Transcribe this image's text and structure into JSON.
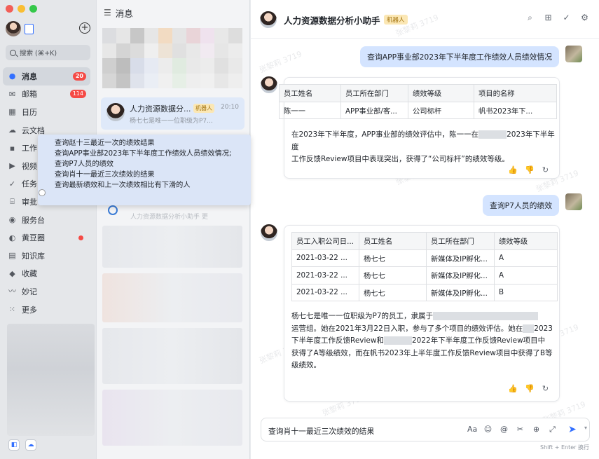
{
  "sidebar": {
    "search_placeholder": "搜索 (⌘+K)",
    "items": [
      {
        "label": "消息",
        "icon": "message-icon",
        "badge": "20",
        "active": true
      },
      {
        "label": "邮箱",
        "icon": "mail-icon",
        "badge": "114"
      },
      {
        "label": "日历",
        "icon": "calendar-icon"
      },
      {
        "label": "云文档",
        "icon": "cloud-docs-icon"
      },
      {
        "label": "工作",
        "icon": "workplace-icon"
      },
      {
        "label": "视频",
        "icon": "video-icon"
      },
      {
        "label": "任务",
        "icon": "task-icon"
      },
      {
        "label": "审批",
        "icon": "approval-icon"
      },
      {
        "label": "服务台",
        "icon": "service-desk-icon"
      },
      {
        "label": "黄豆圈",
        "icon": "moments-icon",
        "dot": true
      },
      {
        "label": "知识库",
        "icon": "wiki-icon"
      },
      {
        "label": "收藏",
        "icon": "favorites-icon"
      },
      {
        "label": "妙记",
        "icon": "minutes-icon"
      },
      {
        "label": "更多",
        "icon": "more-icon"
      }
    ]
  },
  "list": {
    "title": "消息",
    "chat": {
      "name": "人力资源数据分...",
      "tag": "机器人",
      "time": "20:10",
      "preview": "杨七七是唯一一位职级为P7..."
    },
    "second_preview": "人力资源数据分析小助手 更"
  },
  "popup": {
    "lines": [
      "查询赵十三最近一次的绩效结果",
      "查询APP事业部2023年下半年度工作绩效人员绩效情况;",
      "查询P7人员的绩效",
      "查询肖十一最近三次绩效的结果",
      "查询最新绩效和上一次绩效相比有下滑的人"
    ]
  },
  "header": {
    "title": "人力资源数据分析小助手",
    "tag": "机器人"
  },
  "watermark": "张黎莉 3719",
  "messages": {
    "q1": "查询APP事业部2023年下半年度工作绩效人员绩效情况",
    "a1": {
      "columns": [
        "员工姓名",
        "员工所在部门",
        "绩效等级",
        "项目的名称"
      ],
      "rows": [
        [
          "陈一一",
          "APP事业部/客...",
          "公司标杆",
          "帆书2023年下..."
        ]
      ],
      "text_line1_a": "在2023年下半年度，APP事业部的绩效评估中，陈一一在",
      "text_line1_b": "2023年下半年度",
      "text_line2": "工作反馈Review项目中表现突出，获得了“公司标杆”的绩效等级。"
    },
    "q2": "查询P7人员的绩效",
    "a2": {
      "columns": [
        "员工入职公司日...",
        "员工姓名",
        "员工所在部门",
        "绩效等级"
      ],
      "rows": [
        [
          "2021-03-22 ...",
          "杨七七",
          "新媒体及IP孵化...",
          "A"
        ],
        [
          "2021-03-22 ...",
          "杨七七",
          "新媒体及IP孵化...",
          "A"
        ],
        [
          "2021-03-22 ...",
          "杨七七",
          "新媒体及IP孵化...",
          "B"
        ]
      ],
      "line1": "杨七七是唯一一位职级为P7的员工，隶属于",
      "line2_a": "运营组。她在2021年3月22日入职，参与了多个项目的绩效评估。她在",
      "line2_b": "2023",
      "line3": "下半年度工作反馈Review和",
      "line3_b": "2022年下半年度工作反馈Review项目中",
      "line4": "获得了A等级绩效，而在帆书2023年上半年度工作反馈Review项目中获得了B等",
      "line5": "级绩效。"
    }
  },
  "input": {
    "value": "查询肖十一最近三次绩效的结果",
    "hint": "Shift + Enter 换行"
  },
  "colors": {
    "accent": "#3370ff",
    "user_bubble": "#d4e4ff",
    "badge": "#f54a45",
    "bot_tag": "#fbe7b4"
  }
}
